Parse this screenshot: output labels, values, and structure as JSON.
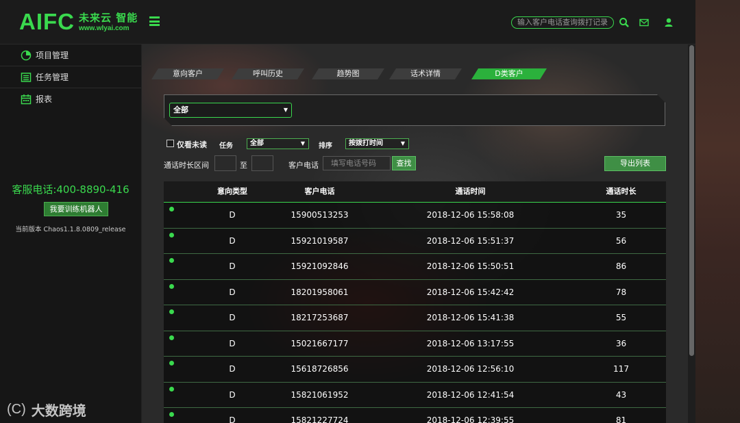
{
  "header": {
    "logo_mark": "AIFC",
    "logo_cn": "未来云 智能",
    "logo_url": "www.wlyai.com",
    "search_placeholder": "输入客户电话查询拨打记录"
  },
  "sidebar": {
    "items": [
      {
        "label": "项目管理",
        "icon": "pie-chart-icon"
      },
      {
        "label": "任务管理",
        "icon": "task-list-icon"
      },
      {
        "label": "报表",
        "icon": "calendar-icon"
      }
    ],
    "hotline": "客服电话:400-8890-416",
    "train_button": "我要训练机器人",
    "version": "当前版本 Chaos1.1.8.0809_release"
  },
  "tabs": [
    {
      "label": "意向客户",
      "active": false
    },
    {
      "label": "呼叫历史",
      "active": false
    },
    {
      "label": "趋势图",
      "active": false
    },
    {
      "label": "话术详情",
      "active": false
    },
    {
      "label": "D类客户",
      "active": true
    }
  ],
  "filters": {
    "main_select": "全部",
    "only_unread": "仅看未读",
    "task_label": "任务",
    "task_value": "全部",
    "sort_label": "排序",
    "sort_value": "按拨打时间",
    "duration_label": "通话时长区间",
    "to_label": "至",
    "phone_label": "客户电话",
    "phone_placeholder": "填写电话号码",
    "search_button": "查找",
    "export_button": "导出列表"
  },
  "table": {
    "headers": [
      "意向类型",
      "客户电话",
      "通话时间",
      "通话时长"
    ],
    "rows": [
      {
        "type": "D",
        "phone": "15900513253",
        "time": "2018-12-06 15:58:08",
        "duration": "35"
      },
      {
        "type": "D",
        "phone": "15921019587",
        "time": "2018-12-06 15:51:37",
        "duration": "56"
      },
      {
        "type": "D",
        "phone": "15921092846",
        "time": "2018-12-06 15:50:51",
        "duration": "86"
      },
      {
        "type": "D",
        "phone": "18201958061",
        "time": "2018-12-06 15:42:42",
        "duration": "78"
      },
      {
        "type": "D",
        "phone": "18217253687",
        "time": "2018-12-06 15:41:38",
        "duration": "55"
      },
      {
        "type": "D",
        "phone": "15021667177",
        "time": "2018-12-06 13:17:55",
        "duration": "36"
      },
      {
        "type": "D",
        "phone": "15618726856",
        "time": "2018-12-06 12:56:10",
        "duration": "117"
      },
      {
        "type": "D",
        "phone": "15821061952",
        "time": "2018-12-06 12:41:54",
        "duration": "43"
      },
      {
        "type": "D",
        "phone": "15821227724",
        "time": "2018-12-06 12:39:55",
        "duration": "81"
      }
    ]
  },
  "watermark": {
    "logo": "(C)",
    "text": "大数跨境"
  },
  "colors": {
    "accent": "#3ad94e",
    "button": "#3f8f45"
  }
}
